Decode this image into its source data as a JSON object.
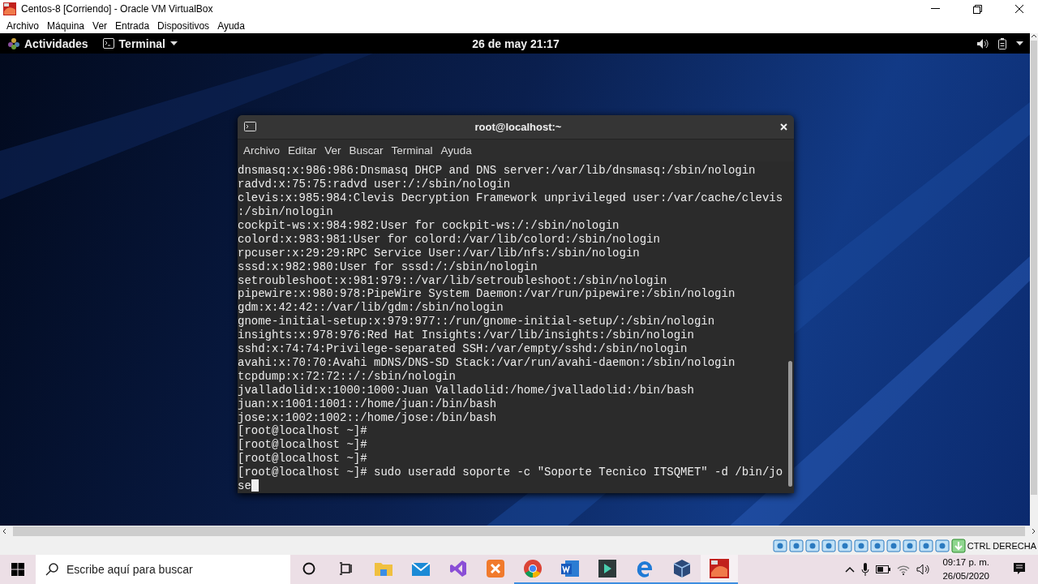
{
  "host_window": {
    "title": "Centos-8 [Corriendo] - Oracle VM VirtualBox",
    "menu": [
      "Archivo",
      "Máquina",
      "Ver",
      "Entrada",
      "Dispositivos",
      "Ayuda"
    ]
  },
  "gnome_bar": {
    "activities": "Actividades",
    "app_menu": "Terminal",
    "clock": "26 de may  21:17"
  },
  "terminal": {
    "title": "root@localhost:~",
    "menu": [
      "Archivo",
      "Editar",
      "Ver",
      "Buscar",
      "Terminal",
      "Ayuda"
    ],
    "lines": [
      "dnsmasq:x:986:986:Dnsmasq DHCP and DNS server:/var/lib/dnsmasq:/sbin/nologin",
      "radvd:x:75:75:radvd user:/:/sbin/nologin",
      "clevis:x:985:984:Clevis Decryption Framework unprivileged user:/var/cache/clevis",
      ":/sbin/nologin",
      "cockpit-ws:x:984:982:User for cockpit-ws:/:/sbin/nologin",
      "colord:x:983:981:User for colord:/var/lib/colord:/sbin/nologin",
      "rpcuser:x:29:29:RPC Service User:/var/lib/nfs:/sbin/nologin",
      "sssd:x:982:980:User for sssd:/:/sbin/nologin",
      "setroubleshoot:x:981:979::/var/lib/setroubleshoot:/sbin/nologin",
      "pipewire:x:980:978:PipeWire System Daemon:/var/run/pipewire:/sbin/nologin",
      "gdm:x:42:42::/var/lib/gdm:/sbin/nologin",
      "gnome-initial-setup:x:979:977::/run/gnome-initial-setup/:/sbin/nologin",
      "insights:x:978:976:Red Hat Insights:/var/lib/insights:/sbin/nologin",
      "sshd:x:74:74:Privilege-separated SSH:/var/empty/sshd:/sbin/nologin",
      "avahi:x:70:70:Avahi mDNS/DNS-SD Stack:/var/run/avahi-daemon:/sbin/nologin",
      "tcpdump:x:72:72::/:/sbin/nologin",
      "jvalladolid:x:1000:1000:Juan Valladolid:/home/jvalladolid:/bin/bash",
      "juan:x:1001:1001::/home/juan:/bin/bash",
      "jose:x:1002:1002::/home/jose:/bin/bash",
      "[root@localhost ~]#",
      "[root@localhost ~]#",
      "[root@localhost ~]#",
      "[root@localhost ~]# sudo useradd soporte -c \"Soporte Tecnico ITSQMET\" -d /bin/jo",
      "se"
    ]
  },
  "vm_status": {
    "host_key": "CTRL DERECHA"
  },
  "taskbar": {
    "search_placeholder": "Escribe aquí para buscar",
    "apps": [
      {
        "kind": "folder",
        "running": false,
        "selected": false
      },
      {
        "kind": "mail",
        "running": false,
        "selected": false
      },
      {
        "kind": "studio",
        "running": false,
        "selected": false
      },
      {
        "kind": "xampp",
        "running": false,
        "selected": false
      },
      {
        "kind": "chrome",
        "running": true,
        "selected": false
      },
      {
        "kind": "word",
        "running": true,
        "selected": false
      },
      {
        "kind": "editor",
        "running": true,
        "selected": false
      },
      {
        "kind": "edge",
        "running": true,
        "selected": false
      },
      {
        "kind": "cube",
        "running": true,
        "selected": false
      },
      {
        "kind": "vm",
        "running": true,
        "selected": true
      }
    ],
    "time": "09:17 p. m.",
    "date": "26/05/2020"
  }
}
